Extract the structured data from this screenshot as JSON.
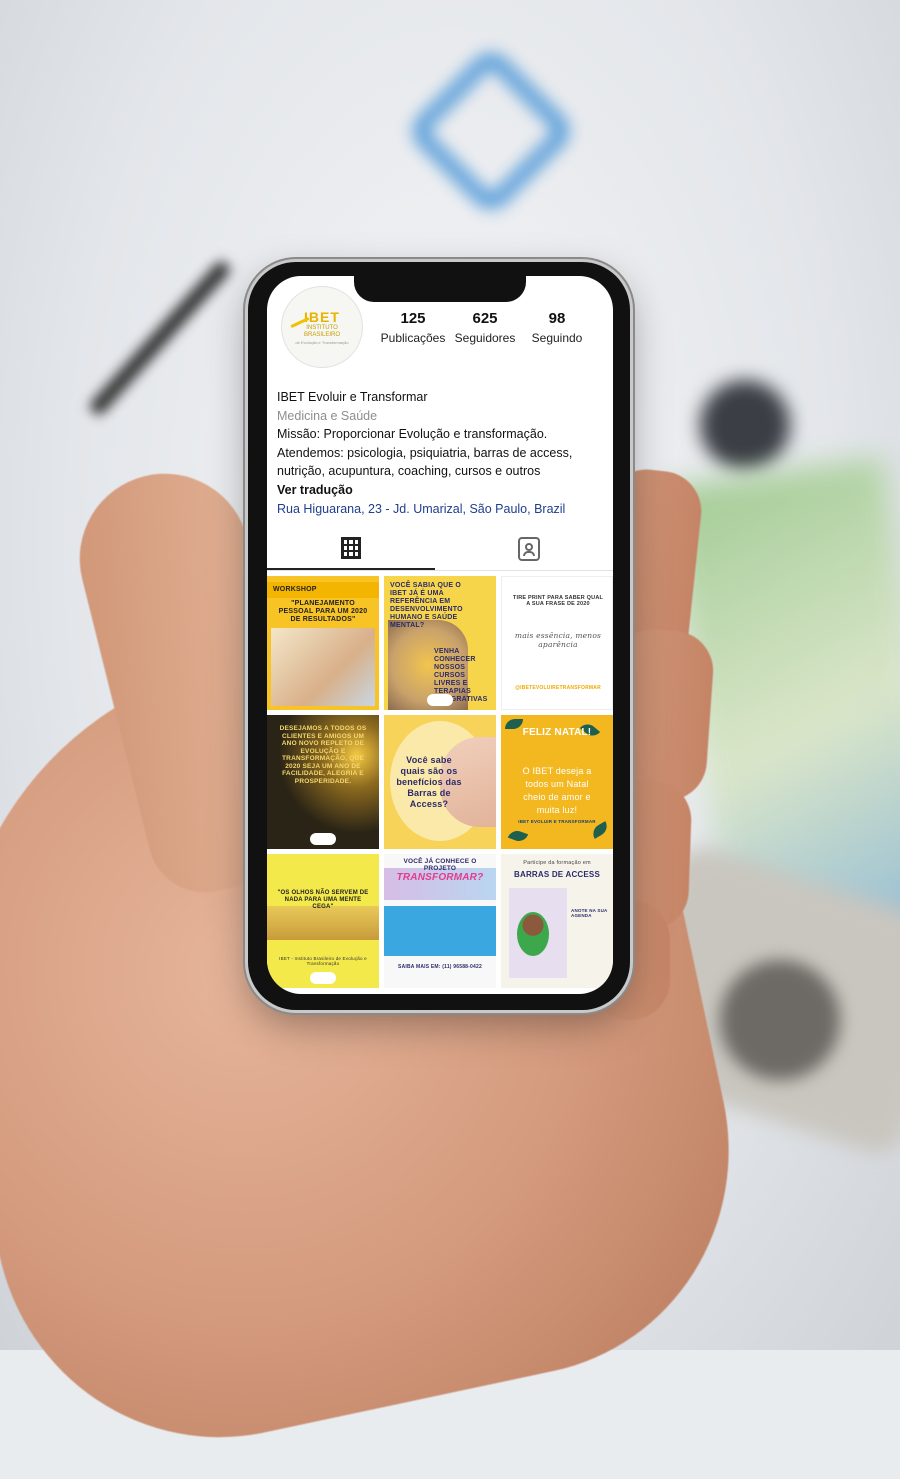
{
  "profile": {
    "avatar_logo": "IBET",
    "avatar_subtitle": "INSTITUTO BRASILEIRO",
    "avatar_tagline": "de Evolução e Transformação",
    "stats": [
      {
        "value": "125",
        "label": "Publicações"
      },
      {
        "value": "625",
        "label": "Seguidores"
      },
      {
        "value": "98",
        "label": "Seguindo"
      }
    ],
    "name": "IBET Evoluir e Transformar",
    "category": "Medicina e Saúde",
    "bio_line1": "Missão: Proporcionar Evolução e transformação.",
    "bio_line2": "Atendemos: psicologia, psiquiatria, barras de access,",
    "bio_line3": "nutrição, acupuntura, coaching, cursos e outros",
    "see_translation": "Ver tradução",
    "address": "Rua Higuarana, 23 - Jd. Umarizal, São Paulo, Brazil"
  },
  "tabs": [
    {
      "name": "grid-icon",
      "active": true
    },
    {
      "name": "tagged-icon",
      "active": false
    }
  ],
  "posts": {
    "p1": {
      "header": "WORKSHOP",
      "title": "\"PLANEJAMENTO PESSOAL PARA UM 2020 DE RESULTADOS\""
    },
    "p2": {
      "title": "VOCÊ SABIA QUE O IBET JÁ É UMA REFERÊNCIA EM DESENVOLVIMENTO HUMANO E SAÚDE MENTAL?",
      "footer": "VENHA CONHECER NOSSOS CURSOS LIVRES E TERAPIAS INTEGRATIVAS"
    },
    "p3": {
      "top": "TIRE PRINT PARA SABER QUAL A SUA FRASE DE 2020",
      "script": "mais essência, menos aparência",
      "bottom": "@IBETEVOLUIRETRANSFORMAR"
    },
    "p4": {
      "title": "DESEJAMOS A TODOS OS CLIENTES E AMIGOS UM ANO NOVO REPLETO DE EVOLUÇÃO E TRANSFORMAÇÃO, QUE 2020 SEJA UM ANO DE FACILIDADE, ALEGRIA E PROSPERIDADE."
    },
    "p5": {
      "title": "Você sabe quais são os benefícios das Barras de Access?"
    },
    "p6": {
      "title": "FELIZ NATAL!",
      "body": "O IBET deseja a todos um Natal cheio de amor e muita luz!",
      "footer": "IBET EVOLUIR E TRANSFORMAR"
    },
    "p7": {
      "title": "\"OS OLHOS NÃO SERVEM DE NADA PARA UMA MENTE CEGA\"",
      "footer": "IBET - Instituto Brasileiro de Evolução e Transformação"
    },
    "p8": {
      "top": "VOCÊ JÁ CONHECE O PROJETO",
      "brand": "TRANSFORMAR?",
      "cta": "SAIBA MAIS EM: (11) 96588-0422"
    },
    "p9": {
      "top": "Participe da formação em",
      "title": "BARRAS DE ACCESS",
      "side": "ANOTE NA SUA AGENDA"
    }
  },
  "colors": {
    "link": "#1f3f8c",
    "muted": "#8e8e8e",
    "accent_yellow": "#f7c325"
  }
}
